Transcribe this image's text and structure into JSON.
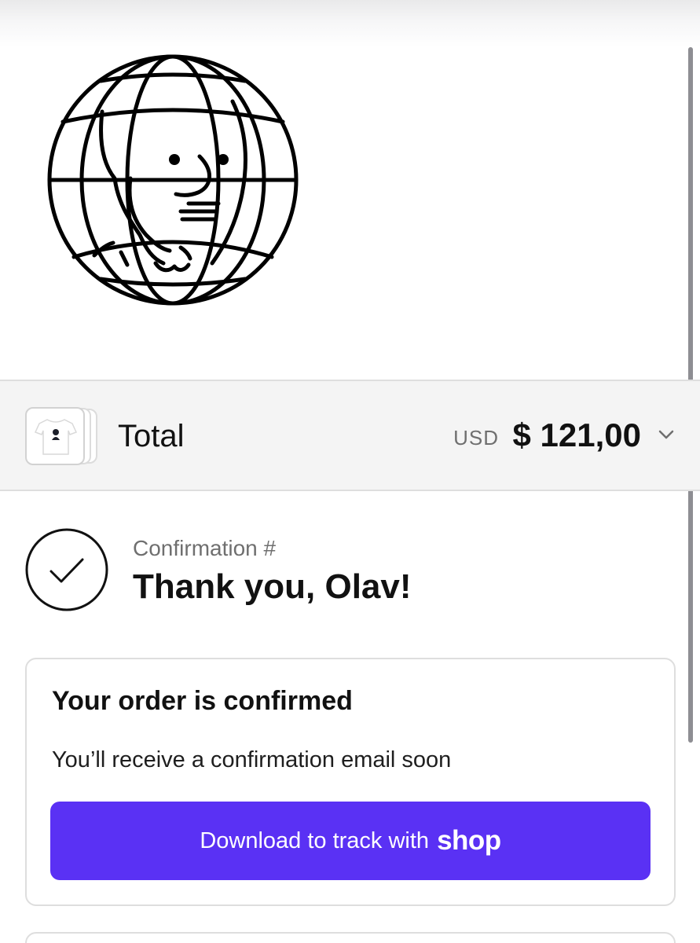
{
  "header": {
    "logo_icon": "globe-face-logo"
  },
  "order_summary": {
    "label": "Total",
    "currency_code": "USD",
    "amount": "$ 121,00",
    "toggle_icon": "chevron-down-icon",
    "thumbnail_icon": "tshirt-thumbnail"
  },
  "confirmation": {
    "label": "Confirmation #",
    "heading": "Thank you, Olav!",
    "status_icon": "checkmark-circle-icon"
  },
  "order_card": {
    "title": "Your order is confirmed",
    "message": "You’ll receive a confirmation email soon",
    "button": {
      "text": "Download to track with",
      "brand": "shop",
      "color": "#5a31f4"
    }
  },
  "colors": {
    "accent": "#5a31f4",
    "summary_background": "#f4f4f4",
    "border": "#dedede"
  }
}
